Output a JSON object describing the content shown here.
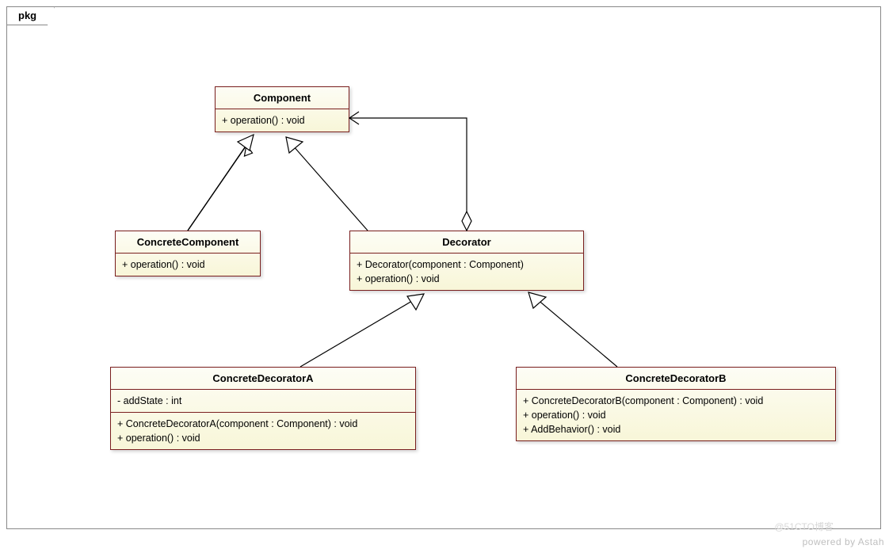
{
  "package_label": "pkg",
  "classes": {
    "component": {
      "name": "Component",
      "ops": [
        "+ operation() : void"
      ]
    },
    "concreteComponent": {
      "name": "ConcreteComponent",
      "ops": [
        "+ operation() : void"
      ]
    },
    "decorator": {
      "name": "Decorator",
      "ops": [
        "+ Decorator(component : Component)",
        "+ operation() : void"
      ]
    },
    "concreteDecoratorA": {
      "name": "ConcreteDecoratorA",
      "attrs": [
        "- addState : int"
      ],
      "ops": [
        "+ ConcreteDecoratorA(component : Component) : void",
        "+ operation() : void"
      ]
    },
    "concreteDecoratorB": {
      "name": "ConcreteDecoratorB",
      "ops": [
        "+ ConcreteDecoratorB(component : Component) : void",
        "+ operation() : void",
        "+ AddBehavior() : void"
      ]
    }
  },
  "credit": "powered by Astah",
  "watermark": "@51CTO博客"
}
